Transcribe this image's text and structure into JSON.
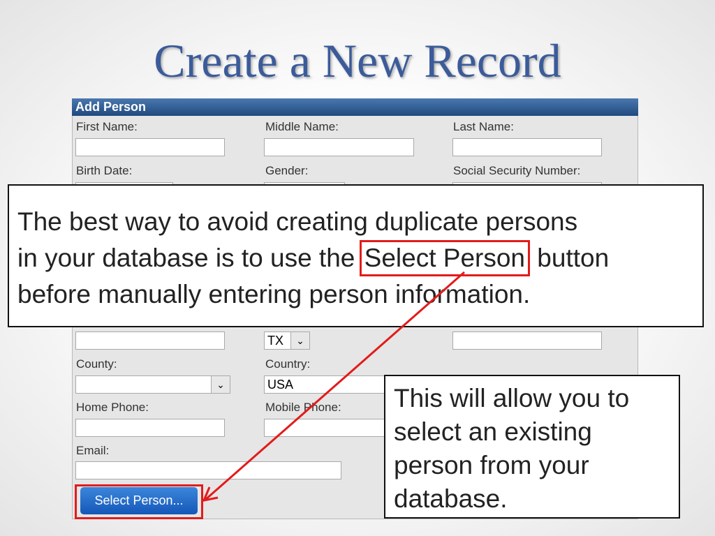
{
  "slide": {
    "title": "Create a New Record"
  },
  "form": {
    "header": "Add Person",
    "labels": {
      "first_name": "First Name:",
      "middle_name": "Middle Name:",
      "last_name": "Last Name:",
      "birth_date": "Birth Date:",
      "gender": "Gender:",
      "ssn": "Social Security Number:",
      "county": "County:",
      "country": "Country:",
      "home_phone": "Home Phone:",
      "mobile_phone": "Mobile Phone:",
      "email": "Email:"
    },
    "values": {
      "state": "TX",
      "country": "USA"
    },
    "select_person_button": "Select Person..."
  },
  "callouts": {
    "main_lines": [
      "The best way to avoid creating duplicate persons",
      "in your database is to use the ",
      "Select Person",
      " button",
      "before manually entering person information."
    ],
    "secondary_lines": [
      "This will allow you to",
      "select an existing",
      "person from your",
      "database."
    ]
  },
  "colors": {
    "title": "#3b5b9a",
    "header": "#1f4a80",
    "highlight": "#e31b1b",
    "button": "#1557b8"
  }
}
